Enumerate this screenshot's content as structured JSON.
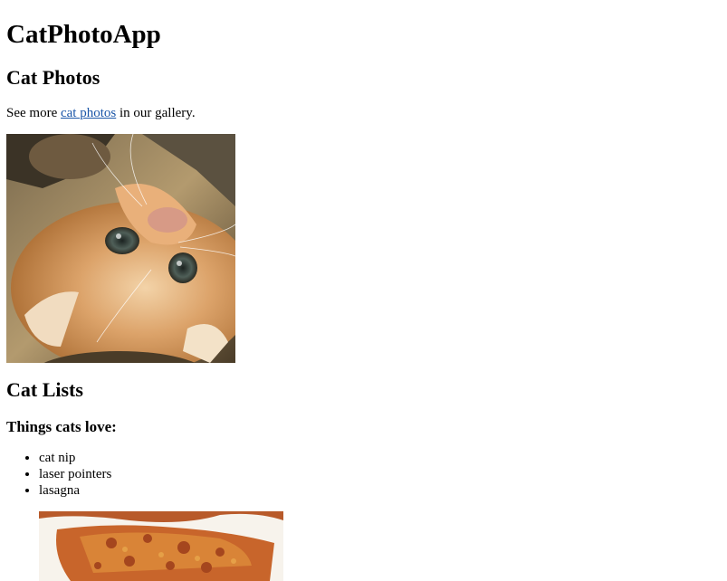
{
  "app": {
    "title": "CatPhotoApp"
  },
  "section_photos": {
    "heading": "Cat Photos",
    "intro_before": "See more ",
    "link_text": "cat photos",
    "intro_after": " in our gallery."
  },
  "kitten_image": {
    "alt": "A cute orange cat lying on its back.",
    "icon": "kitten-photo"
  },
  "section_lists": {
    "heading": "Cat Lists",
    "subheading": "Things cats love:",
    "items": [
      "cat nip",
      "laser pointers",
      "lasagna"
    ]
  },
  "lasagna_image": {
    "alt": "A slice of lasagna on a plate.",
    "icon": "lasagna-photo"
  },
  "colors": {
    "link": "#1a55a8",
    "text": "#000000",
    "background": "#ffffff"
  }
}
